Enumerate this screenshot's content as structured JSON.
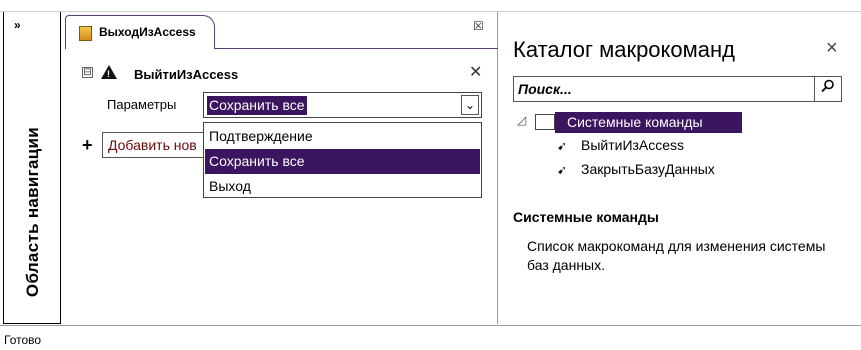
{
  "nav": {
    "toggle": "»",
    "title": "Область навигации"
  },
  "tab": {
    "label": "ВыходИзAccess",
    "close": "☒"
  },
  "action": {
    "collapse": "⊟",
    "warning": "!",
    "title": "ВыйтиИзAccess",
    "delete": "✕",
    "param_label": "Параметры",
    "select_value": "Сохранить все",
    "select_btn": "⌄",
    "options": [
      "Подтверждение",
      "Сохранить все",
      "Выход"
    ],
    "selected_option": "Сохранить все",
    "add_plus": "+",
    "add_text": "Добавить нов"
  },
  "catalog": {
    "title": "Каталог макрокоманд",
    "close": "×",
    "search_placeholder": "Поиск...",
    "search_icon": "search-icon",
    "tree_expander": "◿",
    "group": "Системные команды",
    "items": [
      "ВыйтиИзAccess",
      "ЗакрытьБазуДанных"
    ],
    "item_flag": "➹",
    "desc_title": "Системные команды",
    "desc_text": "Список макрокоманд для изменения системы баз данных."
  },
  "status": {
    "text": "Готово"
  },
  "colors": {
    "selection": "#3b155f",
    "add_text": "#6b0a0a"
  }
}
